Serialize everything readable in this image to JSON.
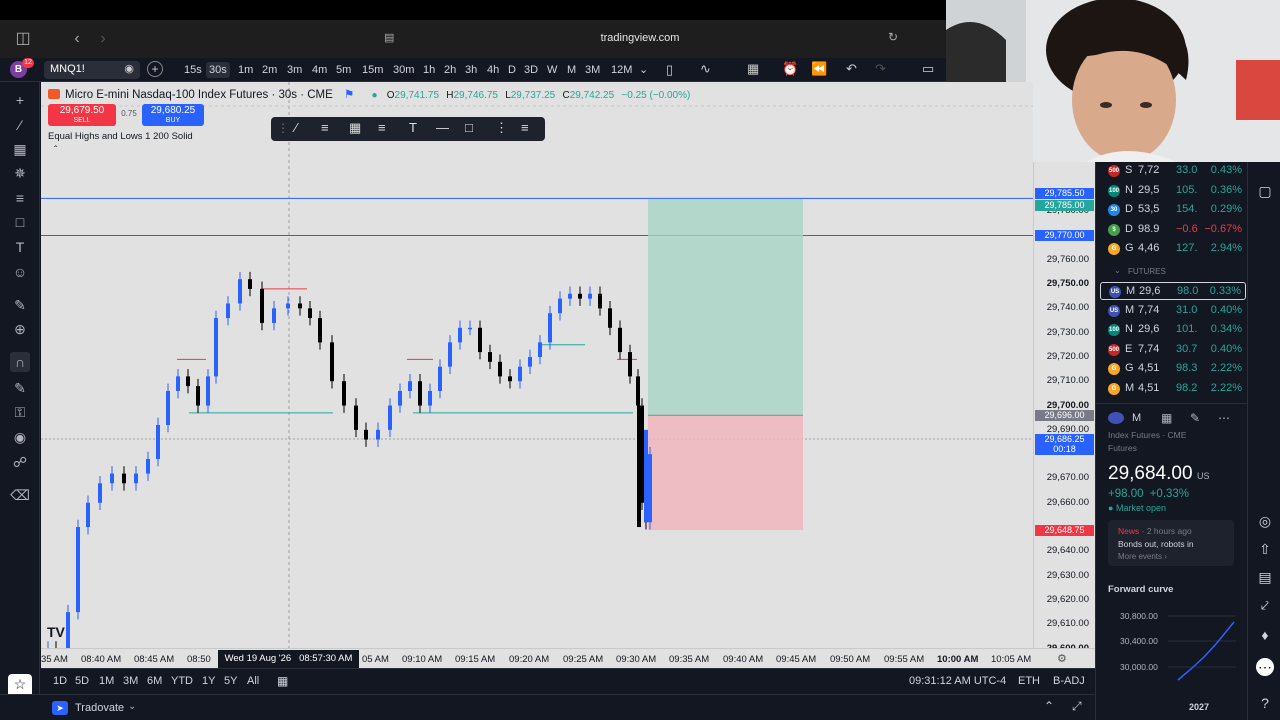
{
  "browser": {
    "url": "tradingview.com",
    "back_icon": "chevron-left-icon",
    "forward_icon": "chevron-right-icon"
  },
  "toolbar": {
    "profile_initial": "B",
    "notification_count": "12",
    "symbol": "MNQ1!",
    "timeframes": [
      "15s",
      "30s",
      "1m",
      "2m",
      "3m",
      "4m",
      "5m",
      "15m",
      "30m",
      "1h",
      "2h",
      "3h",
      "4h",
      "D",
      "3D",
      "W",
      "M",
      "3M",
      "12M"
    ],
    "active_timeframe": "30s"
  },
  "legend": {
    "title": "Micro E-mini Nasdaq-100 Index Futures · 30s · CME",
    "open_label": "O",
    "open": "29,741.75",
    "high_label": "H",
    "high": "29,746.75",
    "low_label": "L",
    "low": "29,737.25",
    "close_label": "C",
    "close": "29,742.25",
    "change": "−0.25 (−0.00%)",
    "sell_price": "29,679.50",
    "sell_label": "SELL",
    "spread": "0.75",
    "buy_price": "29,680.25",
    "buy_label": "BUY",
    "indicator": "Equal Highs and Lows 1 200 Solid"
  },
  "price_axis": {
    "ticks": [
      "29,780.00",
      "29,760.00",
      "29,750.00",
      "29,740.00",
      "29,730.00",
      "29,720.00",
      "29,710.00",
      "29,700.00",
      "29,690.00",
      "29,670.00",
      "29,660.00",
      "29,640.00",
      "29,630.00",
      "29,620.00",
      "29,610.00",
      "29,600.00"
    ],
    "labels": {
      "tp_upper": "29,785.50",
      "tp_lower": "29,785.00",
      "level_line": "29,770.00",
      "entry": "29,696.00",
      "last_price": "29,686.25",
      "countdown": "00:18",
      "stop": "29,648.75"
    }
  },
  "time_axis": {
    "ticks": [
      "35 AM",
      "08:40 AM",
      "08:45 AM",
      "08:50",
      "05 AM",
      "09:10 AM",
      "09:15 AM",
      "09:20 AM",
      "09:25 AM",
      "09:30 AM",
      "09:35 AM",
      "09:40 AM",
      "09:45 AM",
      "09:50 AM",
      "09:55 AM",
      "10:00 AM",
      "10:05 AM"
    ],
    "crosshair_label": "Wed 19 Aug '26   08:57:30 AM"
  },
  "range_bar": {
    "ranges": [
      "1D",
      "5D",
      "1M",
      "3M",
      "6M",
      "YTD",
      "1Y",
      "5Y",
      "All"
    ],
    "clock": "09:31:12 AM UTC-4",
    "session": "ETH",
    "adjustment": "B-ADJ"
  },
  "status_bar": {
    "broker": "Tradovate"
  },
  "watchlist": {
    "section_label": "FUTURES",
    "top_rows": [
      {
        "icon_text": "500",
        "icon_color": "#c62828",
        "sym": "S",
        "last": "7,72",
        "chg": "33.0",
        "pct": "0.43%",
        "dir": "pos"
      },
      {
        "icon_text": "100",
        "icon_color": "#00897b",
        "sym": "N",
        "last": "29,5",
        "chg": "105.",
        "pct": "0.36%",
        "dir": "pos"
      },
      {
        "icon_text": "30",
        "icon_color": "#1e88e5",
        "sym": "D",
        "last": "53,5",
        "chg": "154.",
        "pct": "0.29%",
        "dir": "pos"
      },
      {
        "icon_text": "$",
        "icon_color": "#43a047",
        "sym": "D",
        "last": "98.9",
        "chg": "−0.6",
        "pct": "−0.67%",
        "dir": "neg"
      },
      {
        "icon_text": "G",
        "icon_color": "#f9a825",
        "sym": "G",
        "last": "4,46",
        "chg": "127.",
        "pct": "2.94%",
        "dir": "pos"
      }
    ],
    "future_rows": [
      {
        "icon_text": "US",
        "icon_color": "#3f51b5",
        "sym": "M",
        "last": "29,6",
        "chg": "98.0",
        "pct": "0.33%",
        "dir": "pos"
      },
      {
        "icon_text": "US",
        "icon_color": "#3f51b5",
        "sym": "M",
        "last": "7,74",
        "chg": "31.0",
        "pct": "0.40%",
        "dir": "pos"
      },
      {
        "icon_text": "100",
        "icon_color": "#00897b",
        "sym": "N",
        "last": "29,6",
        "chg": "101.",
        "pct": "0.34%",
        "dir": "pos"
      },
      {
        "icon_text": "500",
        "icon_color": "#c62828",
        "sym": "E",
        "last": "7,74",
        "chg": "30.7",
        "pct": "0.40%",
        "dir": "pos"
      },
      {
        "icon_text": "G",
        "icon_color": "#f9a825",
        "sym": "G",
        "last": "4,51",
        "chg": "98.3",
        "pct": "2.22%",
        "dir": "pos"
      },
      {
        "icon_text": "G",
        "icon_color": "#f9a825",
        "sym": "M",
        "last": "4,51",
        "chg": "98.2",
        "pct": "2.22%",
        "dir": "pos"
      }
    ]
  },
  "details": {
    "symbol_short": "M",
    "subtitle": "Index Futures · CME",
    "category": "Futures",
    "price_main": "29,6",
    "price_tail": "84.00",
    "currency": "US",
    "change": "+98.00",
    "change_pct": "+0.33%",
    "market_status": "Market open",
    "news_label": "News",
    "news_time": "· 2 hours ago",
    "news_headline": "Bonds out, robots in",
    "news_more": "More events ›",
    "forward_curve_title": "Forward curve",
    "curve_ticks": [
      "30,800.00",
      "30,400.00",
      "30,000.00"
    ],
    "curve_year": "2027"
  },
  "colors": {
    "accent": "#2962ff",
    "up": "#26a69a",
    "down": "#f23645",
    "chart_bg": "#e1e1e1",
    "candle_up": "#2962ff",
    "candle_down": "#000000"
  }
}
